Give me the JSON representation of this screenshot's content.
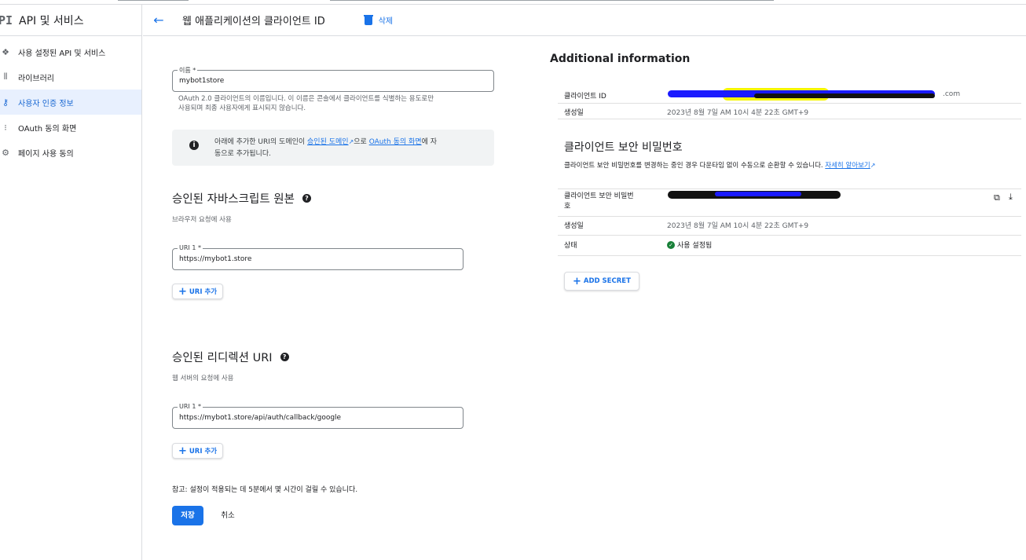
{
  "app": {
    "logo": "PI",
    "title": "API 및 서비스"
  },
  "sidebar": {
    "items": [
      {
        "label": "사용 설정된 API 및 서비스",
        "icon": "api-icon"
      },
      {
        "label": "라이브러리",
        "icon": "library-icon"
      },
      {
        "label": "사용자 인증 정보",
        "icon": "key-icon",
        "active": true
      },
      {
        "label": "OAuth 동의 화면",
        "icon": "consent-icon"
      },
      {
        "label": "페이지 사용 동의",
        "icon": "settings-icon"
      }
    ]
  },
  "header": {
    "back_icon": "←",
    "title": "웹 애플리케이션의 클라이언트 ID",
    "delete_label": "삭제"
  },
  "form": {
    "name": {
      "label": "이름 *",
      "value": "mybot1store",
      "hint_line1": "OAuth 2.0 클라이언트의 이름입니다. 이 이름은 콘솔에서 클라이언트를 식별하는 용도로만",
      "hint_line2": "사용되며 최종 사용자에게 표시되지 않습니다."
    },
    "info": {
      "pre": "아래에 추가한 URI의 도메인이 ",
      "link1": "승인된 도메인",
      "mid": "으로 ",
      "link2": "OAuth 동의 화면",
      "post": "에 자",
      "line2": "동으로 추가됩니다."
    },
    "js_origins": {
      "title": "승인된 자바스크립트 원본",
      "desc": "브라우저 요청에 사용",
      "uri_label": "URI 1 *",
      "uri_value": "https://mybot1.store",
      "add_label": "URI 추가"
    },
    "redirect": {
      "title": "승인된 리디렉션 URI",
      "desc": "웹 서버의 요청에 사용",
      "uri_label": "URI 1 *",
      "uri_value": "https://mybot1.store/api/auth/callback/google",
      "add_label": "URI 추가"
    },
    "note": "참고: 설정이 적용되는 데 5분에서 몇 시간이 걸릴 수 있습니다.",
    "save_label": "저장",
    "cancel_label": "취소"
  },
  "additional": {
    "title": "Additional information",
    "client_id": {
      "key": "클라이언트 ID",
      "value_suffix": ".com"
    },
    "created": {
      "key": "생성일",
      "value": "2023년 8월 7일 AM 10시 4분 22초 GMT+9"
    },
    "secret_section": {
      "title": "클라이언트 보안 비밀번호",
      "desc": "클라이언트 보안 비밀번호를 변경하는 중인 경우 다운타임 없이 수동으로 순환할 수 있습니다. ",
      "learn_more": "자세히 알아보기",
      "secret_key_line1": "클라이언트 보안 비밀번",
      "secret_key_line2": "호",
      "created_key": "생성일",
      "created_value": "2023년 8월 7일 AM 10시 4분 22초 GMT+9",
      "status_key": "상태",
      "status_value": "사용 설정됨",
      "add_secret_label": "ADD SECRET"
    }
  },
  "colors": {
    "accent": "#1a73e8",
    "active_bg": "#e8f0fe",
    "status_ok": "#188038",
    "redact_blue": "#1a1aff",
    "redact_yellow": "#f5f500"
  }
}
